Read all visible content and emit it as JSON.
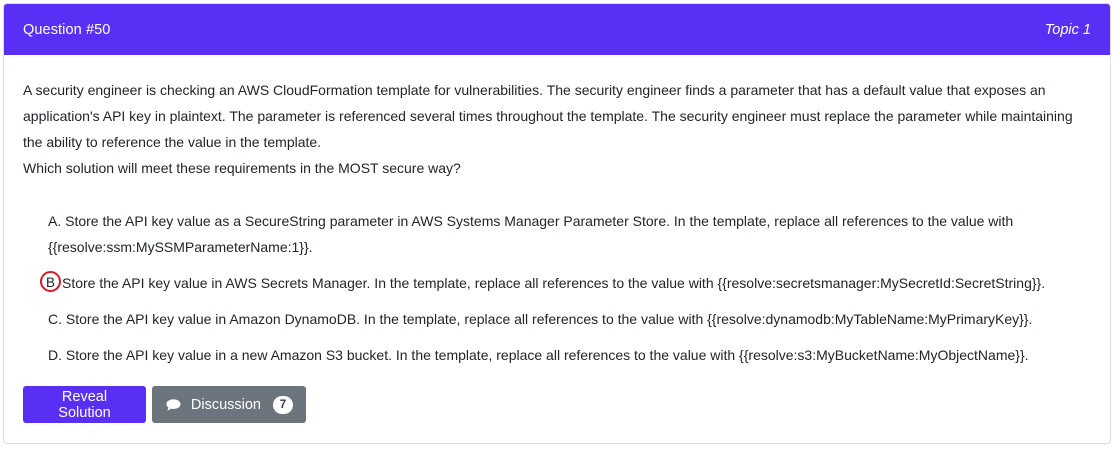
{
  "header": {
    "title": "Question #50",
    "topic": "Topic 1"
  },
  "question": {
    "paragraph": "A security engineer is checking an AWS CloudFormation template for vulnerabilities. The security engineer finds a parameter that has a default value that exposes an application's API key in plaintext. The parameter is referenced several times throughout the template. The security engineer must replace the parameter while maintaining the ability to reference the value in the template.",
    "prompt": "Which solution will meet these requirements in the MOST secure way?"
  },
  "choices": [
    {
      "letter": "A.",
      "text": "Store the API key value as a SecureString parameter in AWS Systems Manager Parameter Store. In the template, replace all references to the value with {{resolve:ssm:MySSMParameterName:1}}."
    },
    {
      "letter": "B.",
      "marked_letter": "B",
      "text": "Store the API key value in AWS Secrets Manager. In the template, replace all references to the value with {{resolve:secretsmanager:MySecretId:SecretString}}."
    },
    {
      "letter": "C.",
      "text": "Store the API key value in Amazon DynamoDB. In the template, replace all references to the value with {{resolve:dynamodb:MyTableName:MyPrimaryKey}}."
    },
    {
      "letter": "D.",
      "text": "Store the API key value in a new Amazon S3 bucket. In the template, replace all references to the value with {{resolve:s3:MyBucketName:MyObjectName}}."
    }
  ],
  "buttons": {
    "reveal_label": "Reveal Solution",
    "discussion_label": "Discussion",
    "discussion_count": "7"
  },
  "icons": {
    "discussion": "chat-bubble-icon"
  },
  "colors": {
    "accent": "#5a2ff5",
    "secondary_button": "#6c757d",
    "mark_circle": "#d11a2a"
  }
}
